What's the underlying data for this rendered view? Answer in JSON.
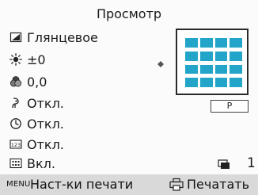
{
  "screen": {
    "title": "Просмотр",
    "settings": [
      {
        "icon": "paper-icon",
        "value": "Глянцевое"
      },
      {
        "icon": "brightness-icon",
        "value": "±0"
      },
      {
        "icon": "color-icon",
        "value": "0,0"
      },
      {
        "icon": "redeye-icon",
        "value": "Откл."
      },
      {
        "icon": "timer-icon",
        "value": "Откл."
      },
      {
        "icon": "date-icon",
        "value": "Откл."
      },
      {
        "icon": "index-icon",
        "value": "Вкл."
      }
    ],
    "paper_tag": "P",
    "copies": "1",
    "accent_color": "#22a5c8"
  },
  "bottom_bar": {
    "menu_key": "MENU",
    "menu_label": "Наст-ки печати",
    "print_label": "Печатать"
  }
}
